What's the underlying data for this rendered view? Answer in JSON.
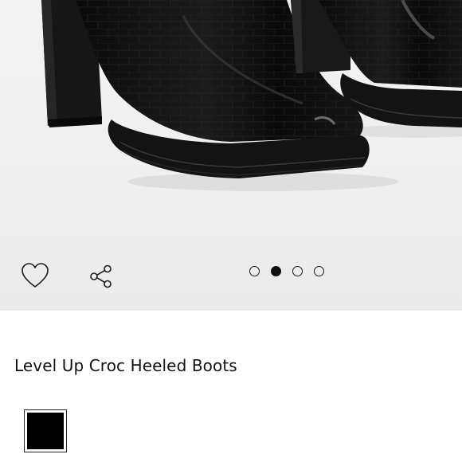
{
  "product": {
    "title": "Level Up Croc Heeled Boots"
  },
  "gallery": {
    "image_count": 4,
    "active_index": 1
  },
  "actions": {
    "wishlist_icon": "heart-outline-icon",
    "share_icon": "share-nodes-icon"
  },
  "swatches": [
    {
      "color": "#000000",
      "selected": true
    }
  ],
  "colors": {
    "boot_leather": "#0c0c0c",
    "sole": "#141414",
    "backdrop": "#f0f0f0"
  }
}
